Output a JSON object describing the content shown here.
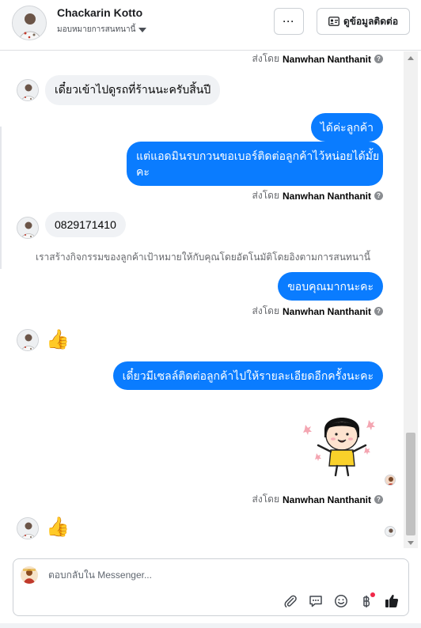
{
  "header": {
    "contact_name": "Chackarin Kotto",
    "assign_label": "มอบหมายการสนทนานี้",
    "more_label": "···",
    "view_contact_label": "ดูข้อมูลติดต่อ"
  },
  "sent_by": {
    "prefix": "ส่งโดย",
    "agent": "Nanwhan Nanthanit",
    "help_glyph": "?"
  },
  "messages": [
    {
      "direction": "in",
      "text": "เดี๋ยวเข้าไปดูรถที่ร้านนะครับสิ้นปี"
    },
    {
      "direction": "out",
      "text": "ได้ค่ะลูกค้า"
    },
    {
      "direction": "out",
      "text_line1": "แต่แอดมินรบกวนขอเบอร์ติดต่อลูกค้าไว้หน่อยได้มั้ย",
      "text_line2": "คะ"
    },
    {
      "direction": "in",
      "text": "0829171410"
    },
    {
      "direction": "system",
      "text": "เราสร้างกิจกรรมของลูกค้าเป้าหมายให้กับคุณโดยอัตโนมัติโดยอิงตามการสนทนานี้"
    },
    {
      "direction": "out",
      "text": "ขอบคุณมากนะคะ"
    },
    {
      "direction": "in",
      "text": "👍"
    },
    {
      "direction": "out",
      "text": "เดี๋ยวมีเซลล์ติดต่อลูกค้าไปให้รายละเอียดอีกครั้งนะคะ"
    },
    {
      "direction": "out",
      "sticker": "girl-hearts-sticker"
    },
    {
      "direction": "in",
      "text": "👍"
    }
  ],
  "composer": {
    "placeholder": "ตอบกลับใน Messenger..."
  },
  "icons": {
    "attach": "paperclip-icon",
    "saved_replies": "chat-bubble-icon",
    "emoji": "smiley-icon",
    "payment": "baht-icon",
    "like": "thumbs-up-icon"
  },
  "colors": {
    "outgoing_bubble": "#0a7cff",
    "incoming_bubble": "#f0f2f5",
    "like_icon": "#1c1e21",
    "notification_dot": "#f02849"
  }
}
